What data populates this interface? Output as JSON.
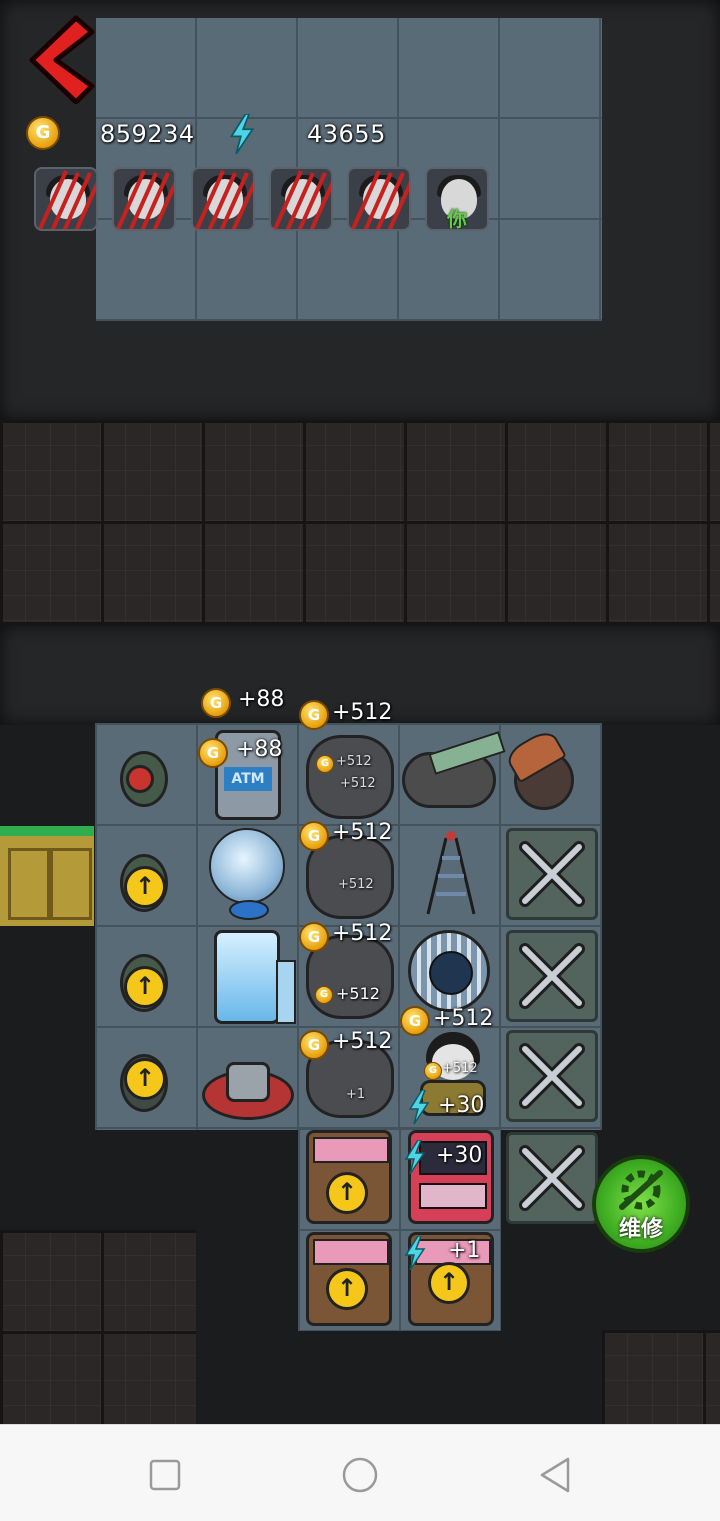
{
  "hud": {
    "gold": "859234",
    "energy": "43655",
    "coin_glyph": "G",
    "you_label": "你"
  },
  "popups": {
    "g88_a": "+88",
    "g88_b": "+88",
    "g512_1": "+512",
    "g512_1s": "+512",
    "g512_1s2": "+512",
    "g512_2": "+512",
    "g512_2s": "+512",
    "g512_3": "+512",
    "g512_3s": "+512",
    "g512_4": "+512",
    "g512_5": "+512",
    "g512_5s": "+512",
    "e30_a": "+30",
    "e30_b": "+30",
    "e1_a": "+1",
    "e1_small": "+1"
  },
  "atm_label": "ATM",
  "repair_label": "维修",
  "colors": {
    "accent_green": "#3fae22",
    "coin_gold": "#e7a00c",
    "back_red": "#e0211f"
  }
}
